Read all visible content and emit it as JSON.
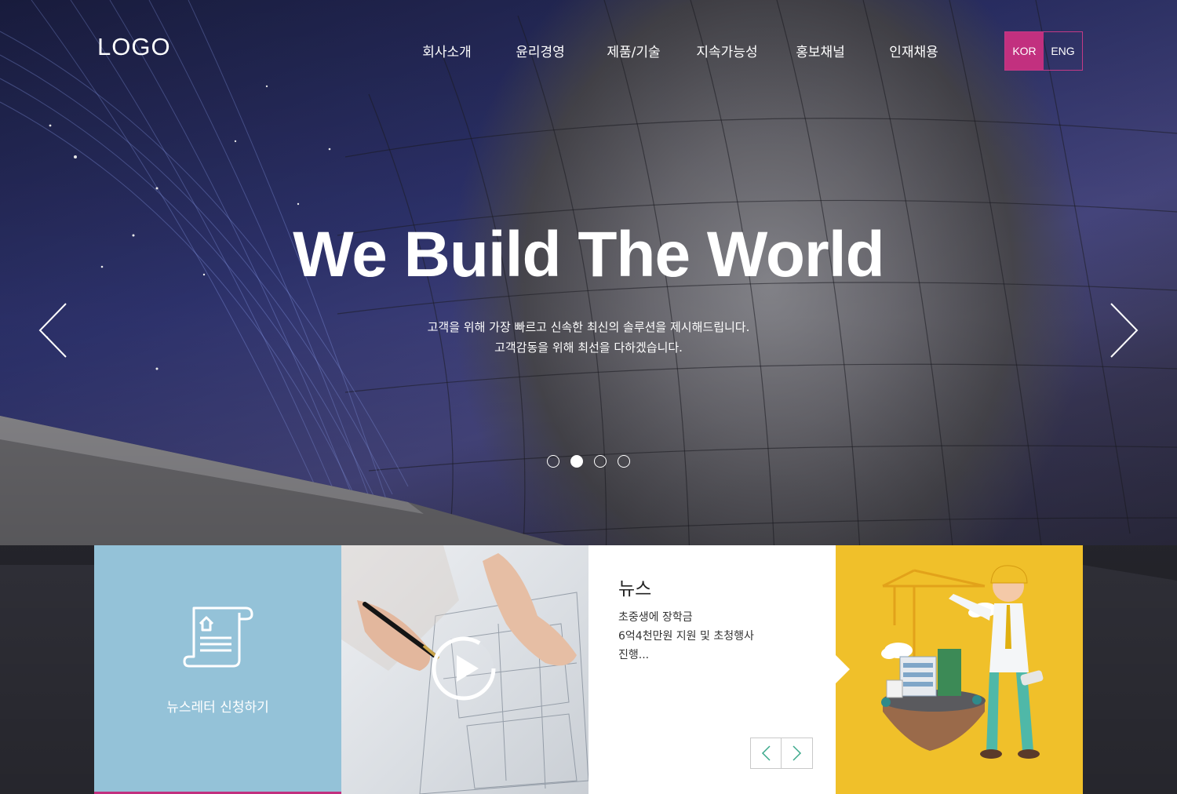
{
  "header": {
    "logo": "LOGO",
    "nav": [
      "회사소개",
      "윤리경영",
      "제품/기술",
      "지속가능성",
      "홍보채널",
      "인재채용"
    ],
    "lang": {
      "kor": "KOR",
      "eng": "ENG",
      "active": "KOR"
    }
  },
  "hero": {
    "title": "We Build The World",
    "subtitle_line1": "고객을 위해 가장 빠르고 신속한 최신의 솔루션을 제시해드립니다.",
    "subtitle_line2": "고객감동을 위해 최선을 다하겠습니다.",
    "slide_count": 4,
    "active_slide": 2
  },
  "cards": {
    "newsletter": {
      "label": "뉴스레터 신청하기",
      "icon": "document-house-icon"
    },
    "video": {
      "icon": "play-icon"
    },
    "news": {
      "title": "뉴스",
      "lines": [
        "초중생에 장학금",
        "6억4천만원 지원 및 초청행사",
        "진행..."
      ]
    }
  },
  "colors": {
    "accent": "#c2307f",
    "newsletter_bg": "#94c2d8",
    "illust_bg": "#f0c02a",
    "news_arrow": "#3aa88a"
  }
}
